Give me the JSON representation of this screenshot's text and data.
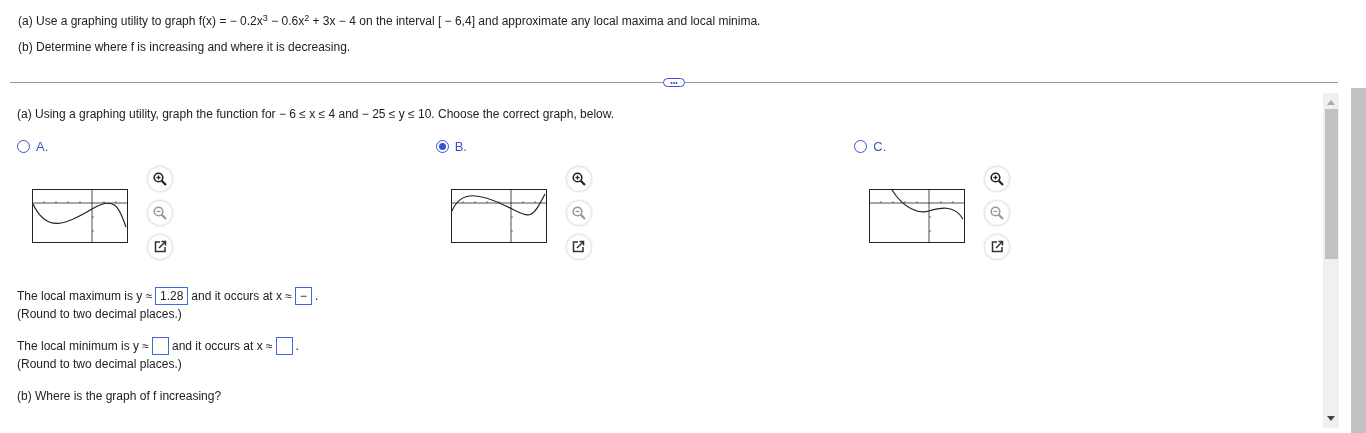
{
  "question": {
    "lines": [
      "(a) Use a graphing utility to graph f(x) = − 0.2x$^{3}$ − 0.6x$^{2}$ + 3x − 4 on the interval [ − 6,4] and approximate any local maxima and local minima.",
      "(b) Determine where f is increasing and where it is decreasing."
    ]
  },
  "divider_button": {
    "label": "•••"
  },
  "part_a": {
    "prompt": "(a) Using a graphing utility, graph the function for  − 6 ≤ x ≤ 4 and  − 25 ≤ y ≤ 10.  Choose the correct graph, below.",
    "options": [
      {
        "label": "A.",
        "selected": false
      },
      {
        "label": "B.",
        "selected": true
      },
      {
        "label": "C.",
        "selected": false
      }
    ]
  },
  "answers": [
    {
      "prefix": "The local maximum is y ≈",
      "y_value": "1.28",
      "middle": "and it occurs at x ≈",
      "x_value": "−",
      "suffix": ".",
      "hint": "(Round to two decimal places.)"
    },
    {
      "prefix": "The local minimum is y ≈",
      "middle": "and it occurs at x ≈",
      "suffix": ".",
      "hint": "(Round to two decimal places.)"
    }
  ],
  "part_b": {
    "prompt": "(b) Where is the graph of f increasing?"
  }
}
